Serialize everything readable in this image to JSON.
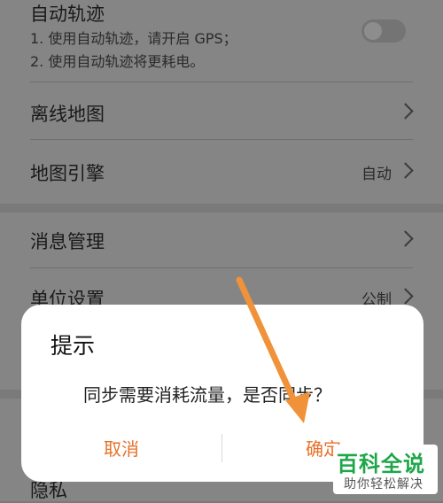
{
  "settings": {
    "auto_track": {
      "label": "自动轨迹",
      "desc1": "1. 使用自动轨迹，请开启 GPS；",
      "desc2": "2. 使用自动轨迹将更耗电。",
      "enabled": false
    },
    "offline_map": {
      "label": "离线地图"
    },
    "map_engine": {
      "label": "地图引擎",
      "value": "自动"
    },
    "message_mgmt": {
      "label": "消息管理"
    },
    "unit_settings": {
      "label": "单位设置",
      "value": "公制"
    },
    "privacy": {
      "label": "隐私"
    }
  },
  "dialog": {
    "title": "提示",
    "message": "同步需要消耗流量，是否同步？",
    "cancel_label": "取消",
    "confirm_label": "确定"
  },
  "watermark": {
    "title": "百科全说",
    "subtitle": "助你轻松解决"
  },
  "colors": {
    "accent": "#e8702a",
    "annotation_arrow": "#f0923a",
    "watermark_green": "#1fa64a"
  }
}
